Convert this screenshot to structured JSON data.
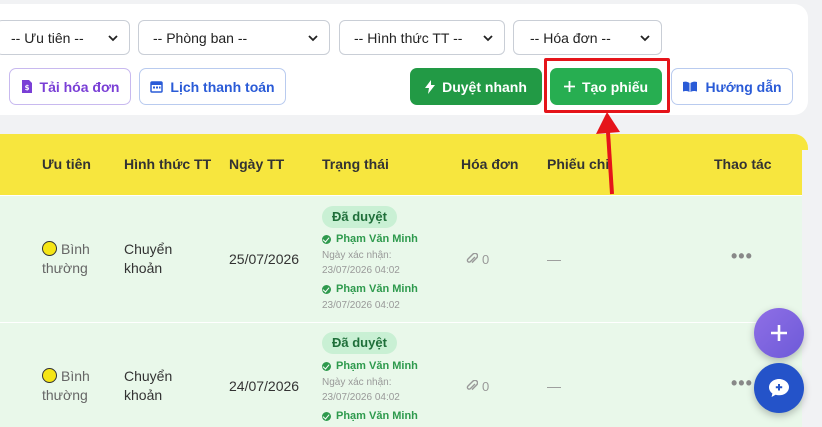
{
  "filters": {
    "priority": "-- Ưu tiên --",
    "department": "-- Phòng ban --",
    "payment_method": "-- Hình thức TT --",
    "invoice": "-- Hóa đơn --"
  },
  "toolbar": {
    "download_invoice": "Tải hóa đơn",
    "payment_schedule": "Lịch thanh toán",
    "quick_approve": "Duyệt nhanh",
    "create_voucher": "Tạo phiếu",
    "guide": "Hướng dẫn"
  },
  "table": {
    "headers": {
      "priority": "Ưu tiên",
      "method": "Hình thức TT",
      "date": "Ngày TT",
      "status": "Trạng thái",
      "invoice": "Hóa đơn",
      "voucher": "Phiếu chi",
      "actions": "Thao tác"
    },
    "rows": [
      {
        "priority_line1": "Bình",
        "priority_line2": "thường",
        "method_line1": "Chuyển",
        "method_line2": "khoản",
        "date": "25/07/2026",
        "status": "Đã duyệt",
        "approver1": "Phạm Văn Minh",
        "confirm_label": "Ngày xác nhận:",
        "confirm_date": "23/07/2026 04:02",
        "approver2": "Phạm Văn Minh",
        "approve_date2": "23/07/2026 04:02",
        "invoice_count": "0",
        "voucher": "—",
        "actions": "•••"
      },
      {
        "priority_line1": "Bình",
        "priority_line2": "thường",
        "method_line1": "Chuyển",
        "method_line2": "khoản",
        "date": "24/07/2026",
        "status": "Đã duyệt",
        "approver1": "Phạm Văn Minh",
        "confirm_label": "Ngày xác nhận:",
        "confirm_date": "23/07/2026 04:02",
        "approver2": "Phạm Văn Minh",
        "invoice_count": "0",
        "voucher": "—",
        "actions": "•••"
      }
    ]
  },
  "colors": {
    "header_yellow": "#f7e63e",
    "row_green": "#e9f8ea",
    "primary_green": "#229a45",
    "highlight_red": "#e5141a"
  }
}
